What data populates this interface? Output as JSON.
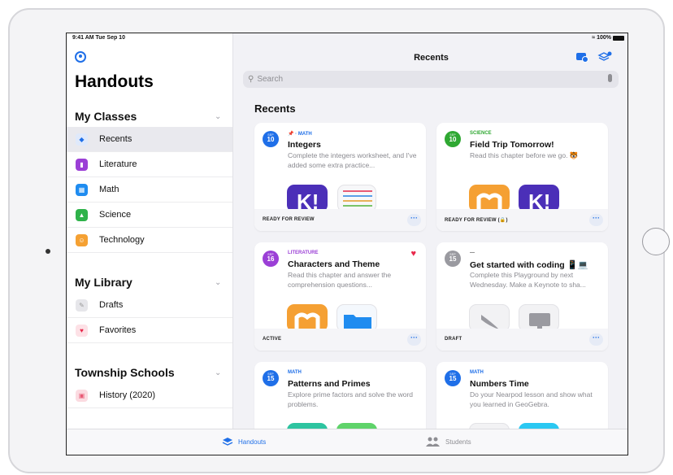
{
  "status": {
    "time": "9:41 AM  Tue Sep 10",
    "battery": "100%"
  },
  "sidebar": {
    "title": "Handouts",
    "sections": [
      {
        "title": "My Classes",
        "items": [
          {
            "label": "Recents",
            "icon": "recents-icon",
            "color": "#1f6fe8",
            "selected": true
          },
          {
            "label": "Literature",
            "icon": "book-icon",
            "color": "#9b3fd6"
          },
          {
            "label": "Math",
            "icon": "calculator-icon",
            "color": "#1f8cf0"
          },
          {
            "label": "Science",
            "icon": "flask-icon",
            "color": "#2fb24a"
          },
          {
            "label": "Technology",
            "icon": "face-icon",
            "color": "#f5a133"
          }
        ]
      },
      {
        "title": "My Library",
        "items": [
          {
            "label": "Drafts",
            "icon": "edit-icon",
            "color": "#c6c6cc"
          },
          {
            "label": "Favorites",
            "icon": "heart-icon",
            "color": "#e8284b"
          }
        ]
      },
      {
        "title": "Township Schools",
        "items": [
          {
            "label": "History (2020)",
            "icon": "building-icon",
            "color": "#e85a75"
          }
        ]
      }
    ]
  },
  "main": {
    "nav_title": "Recents",
    "search_placeholder": "Search",
    "section_title": "Recents",
    "cards": [
      {
        "month": "SEP",
        "day": "10",
        "badge_color": "#1f6fe8",
        "subject": "MATH",
        "subject_color": "#1f6fe8",
        "title": "Integers",
        "desc": "Complete the integers worksheet, and I've added some extra practice...",
        "status": "READY FOR REVIEW"
      },
      {
        "month": "SEP",
        "day": "10",
        "badge_color": "#2fa832",
        "subject": "SCIENCE",
        "subject_color": "#2fa832",
        "title": "Field Trip Tomorrow!",
        "desc": "Read this chapter before we go. 🐯",
        "status": "READY FOR REVIEW (🔒)"
      },
      {
        "month": "SEP",
        "day": "16",
        "badge_color": "#9b3fd6",
        "subject": "LITERATURE",
        "subject_color": "#9b3fd6",
        "title": "Characters and Theme",
        "desc": "Read this chapter and answer the comprehension questions...",
        "status": "ACTIVE"
      },
      {
        "month": "SEP",
        "day": "15",
        "badge_color": "#9a9aa0",
        "subject": "—",
        "subject_color": "#555",
        "title": "Get started with coding 📱💻",
        "desc": "Complete this Playground by next Wednesday. Make a Keynote to sha...",
        "status": "DRAFT"
      },
      {
        "month": "SEP",
        "day": "15",
        "badge_color": "#1f6fe8",
        "subject": "MATH",
        "subject_color": "#1f6fe8",
        "title": "Patterns and Primes",
        "desc": "Explore prime factors and solve the word problems.",
        "status": ""
      },
      {
        "month": "SEP",
        "day": "15",
        "badge_color": "#1f6fe8",
        "subject": "MATH",
        "subject_color": "#1f6fe8",
        "title": "Numbers Time",
        "desc": "Do your Nearpod lesson and show what you learned in GeoGebra.",
        "status": ""
      }
    ]
  },
  "tabbar": {
    "tabs": [
      {
        "label": "Handouts",
        "active": true
      },
      {
        "label": "Students",
        "active": false
      }
    ]
  }
}
